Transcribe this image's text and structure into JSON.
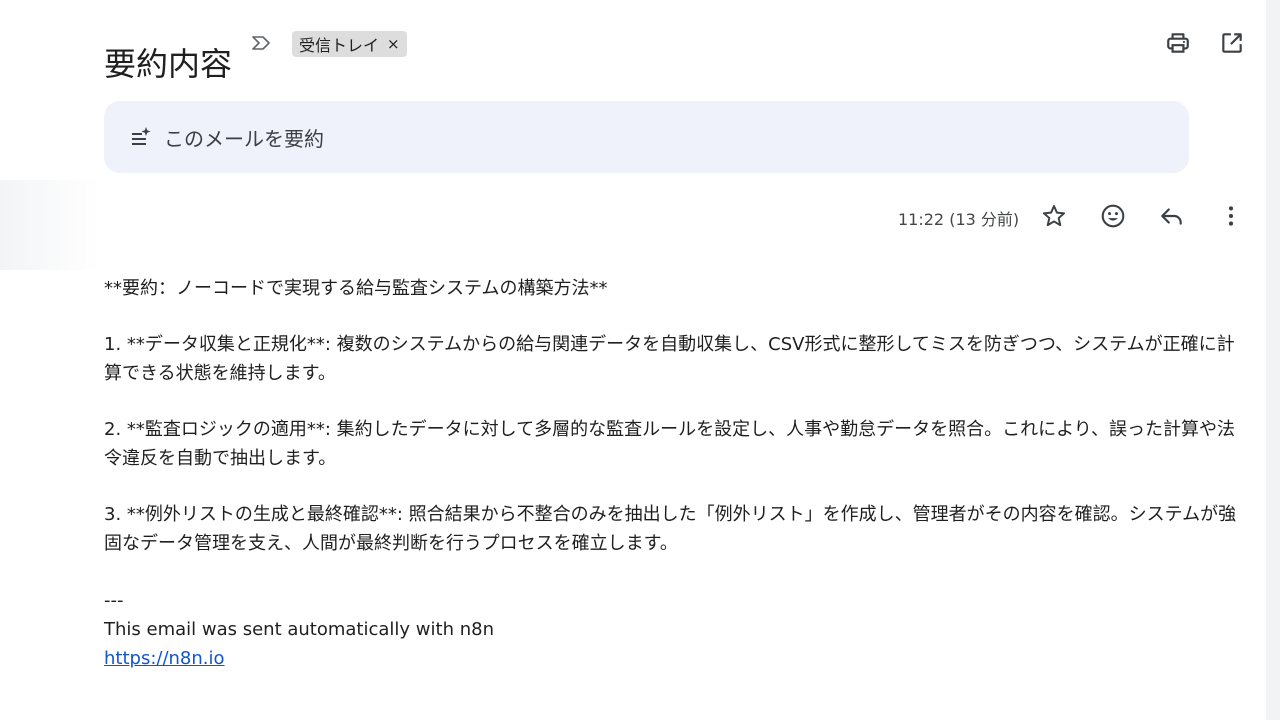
{
  "header": {
    "subject": "要約内容",
    "label_chip": "受信トレイ",
    "label_close": "×"
  },
  "summarize": {
    "label": "このメールを要約"
  },
  "meta": {
    "timestamp": "11:22 (13 分前)"
  },
  "body": {
    "title": "**要約：ノーコードで実現する給与監査システムの構築方法**",
    "items": [
      "1. **データ収集と正規化**: 複数のシステムからの給与関連データを自動収集し、CSV形式に整形してミスを防ぎつつ、システムが正確に計算できる状態を維持します。",
      "2. **監査ロジックの適用**: 集約したデータに対して多層的な監査ルールを設定し、人事や勤怠データを照合。これにより、誤った計算や法令違反を自動で抽出します。",
      "3. **例外リストの生成と最終確認**: 照合結果から不整合のみを抽出した「例外リスト」を作成し、管理者がその内容を確認。システムが強固なデータ管理を支え、人間が最終判断を行うプロセスを確立します。"
    ],
    "separator": "---",
    "footer": "This email was sent automatically with n8n",
    "link": "https://n8n.io"
  },
  "icons": {
    "importance": "importance-marker-icon",
    "print": "print-icon",
    "open_new_window": "open-in-new-window-icon",
    "summarize": "summarize-sparkle-icon",
    "star": "star-icon",
    "emoji": "emoji-reaction-icon",
    "reply": "reply-icon",
    "more": "more-vertical-icon"
  },
  "colors": {
    "summarize_bg": "#eff1fb",
    "chip_bg": "#dddddd",
    "link": "#1155cc",
    "text": "#1f1f1f"
  }
}
